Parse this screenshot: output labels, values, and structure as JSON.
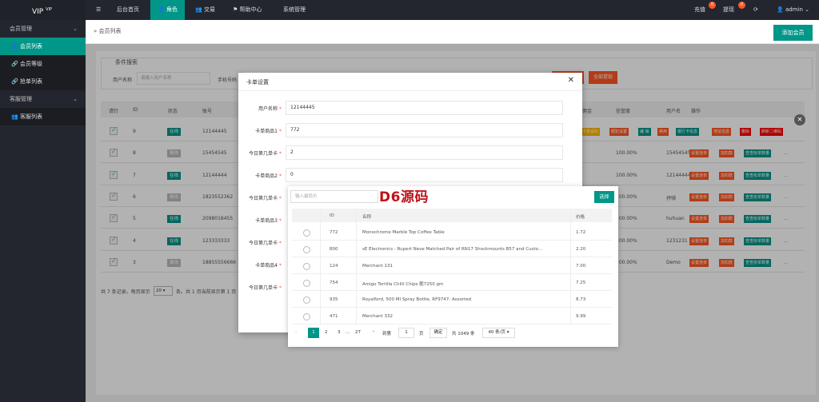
{
  "sidebar": {
    "logo": "VIP",
    "logo_sup": "VIP",
    "groups": [
      {
        "label": "会员管理",
        "chev": "⌄"
      },
      {
        "label": "客服管理",
        "chev": "⌄"
      }
    ],
    "items": [
      {
        "label": "会员列表",
        "icon": "👤"
      },
      {
        "label": "会员等级",
        "icon": "🔗"
      },
      {
        "label": "抢单列表",
        "icon": "🔗"
      },
      {
        "label": "客服列表",
        "icon": "👥"
      }
    ]
  },
  "topbar": {
    "menu_icon": "☰",
    "nav": [
      {
        "label": "后台首页",
        "icon": ""
      },
      {
        "label": "角色",
        "icon": "👤"
      },
      {
        "label": "交易",
        "icon": "👥"
      },
      {
        "label": "帮助中心",
        "icon": "⚑"
      },
      {
        "label": "系统管理",
        "icon": ""
      }
    ],
    "recharge": "充值",
    "recharge_badge": "0",
    "withdraw": "提现",
    "withdraw_badge": "0",
    "refresh_icon": "⟳",
    "user": "admin",
    "user_icon": "👤",
    "user_chev": "⌄"
  },
  "breadcrumb": {
    "arrow": "»",
    "label": "会员列表"
  },
  "add_button": "添加会员",
  "search": {
    "legend": "条件搜索",
    "username_label": "用户名称",
    "username_placeholder": "请输入用户名称",
    "phone_label": "手机号码",
    "btn_right": "全部提现"
  },
  "table": {
    "headers": [
      "请针",
      "ID",
      "状态",
      "账号"
    ],
    "right_headers": [
      "佣金",
      "信誉度",
      "用户名",
      "操作"
    ],
    "rows": [
      {
        "id": "9",
        "status": "在线",
        "on": true,
        "account": "12144445",
        "credit": "",
        "user": ""
      },
      {
        "id": "8",
        "status": "离线",
        "on": false,
        "account": "15454545",
        "credit": "100.00%",
        "user": "15454545"
      },
      {
        "id": "7",
        "status": "在线",
        "on": true,
        "account": "12144444",
        "credit": "100.00%",
        "user": "12144444"
      },
      {
        "id": "6",
        "status": "离线",
        "on": false,
        "account": "1823552362",
        "credit": "100.00%",
        "user": "抒骑"
      },
      {
        "id": "5",
        "status": "在线",
        "on": true,
        "account": "2098018455",
        "credit": "100.00%",
        "user": "huhuan"
      },
      {
        "id": "4",
        "status": "在线",
        "on": true,
        "account": "123333333",
        "credit": "100.00%",
        "user": "1231231"
      },
      {
        "id": "3",
        "status": "离线",
        "on": false,
        "account": "18855556666",
        "credit": "100.00%",
        "user": "Demo"
      }
    ],
    "actions_first": [
      "卡单设针",
      "额犯设置",
      "编 辑",
      "禁用",
      "银行卡信息",
      "地址信息",
      "删除",
      "刷新二维码"
    ],
    "actions": [
      "设置连单",
      "加扣款",
      "查查抢单数量",
      "..."
    ],
    "footer": "共 7 条记录。每页显示",
    "footer_select": "20",
    "footer_rest": "条。共 1 页当前显示第 1 页"
  },
  "modal": {
    "title": "卡单设置",
    "close": "✕",
    "fields": [
      {
        "label": "用户名称",
        "value": "12144445"
      },
      {
        "label": "卡单商品1",
        "value": "772"
      },
      {
        "label": "今日第几单卡",
        "value": "2"
      },
      {
        "label": "卡单商品2",
        "value": "0"
      },
      {
        "label": "今日第几单卡",
        "value": ""
      },
      {
        "label": "卡单商品3",
        "value": ""
      },
      {
        "label": "今日第几单卡",
        "value": ""
      },
      {
        "label": "卡单商品4",
        "value": ""
      },
      {
        "label": "今日第几单卡",
        "value": ""
      }
    ]
  },
  "picker": {
    "search_placeholder": "输入最低价",
    "select_button": "选择",
    "headers": [
      "ID",
      "名称",
      "价格"
    ],
    "rows": [
      {
        "id": "772",
        "name": "Monochrome Marble Top Coffee Table",
        "price": "1.72"
      },
      {
        "id": "800",
        "name": "sE Electronics - Rupert Neve Matched Pair of RN17 Shockmounts B57 and Custo...",
        "price": "2.20"
      },
      {
        "id": "124",
        "name": "Merchant 131",
        "price": "7.00"
      },
      {
        "id": "754",
        "name": "Amigo Tortilla Chilli Chips 脆7250 gm",
        "price": "7.25"
      },
      {
        "id": "935",
        "name": "Royalford, 500 Ml Spray Bottle, RF9747- Assorted",
        "price": "8.73"
      },
      {
        "id": "471",
        "name": "Merchant 332",
        "price": "9.99"
      }
    ],
    "pagination": {
      "prev": "‹",
      "pages": [
        "1",
        "2",
        "3",
        "…",
        "27"
      ],
      "next": "›",
      "goto": "到第",
      "goto_value": "1",
      "page_unit": "页",
      "confirm": "确定",
      "total": "共 1049 条",
      "per_page": "40 条/页"
    }
  },
  "watermark": "D6源码",
  "close_circle": "✕",
  "colors": {
    "accent": "#009688",
    "danger": "#ff5722",
    "sidebar": "#23262e"
  }
}
